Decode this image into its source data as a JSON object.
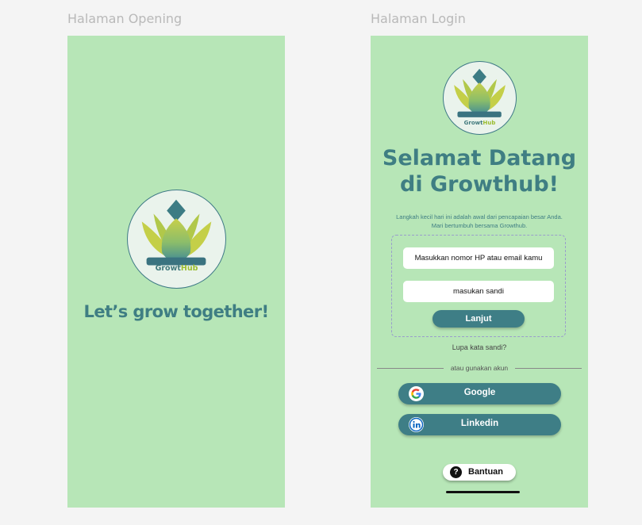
{
  "frames": {
    "opening_title": "Halaman Opening",
    "login_title": "Halaman Login"
  },
  "brand": {
    "name_part1": "Growt",
    "name_part2": "Hub"
  },
  "opening": {
    "tagline": "Let’s grow together!"
  },
  "login": {
    "welcome_line1": "Selamat Datang",
    "welcome_line2": "di Growthub!",
    "subtitle": "Langkah kecil hari ini adalah awal dari pencapaian besar Anda. Mari bertumbuh bersama Growthub.",
    "id_field_placeholder": "Masukkan nomor HP atau email kamu",
    "password_field_placeholder": "masukan sandi",
    "next_button": "Lanjut",
    "forgot_link": "Lupa kata sandi?",
    "divider_text": "atau gunakan akun",
    "google_button": "Google",
    "linkedin_button": "Linkedin",
    "help_button": "Bantuan",
    "help_icon_glyph": "?"
  },
  "colors": {
    "phone_bg": "#b7e6b7",
    "primary": "#3e7e86",
    "logo_green": "#9bbd30"
  },
  "icons": [
    "lotus-logo-icon",
    "google-icon",
    "linkedin-icon",
    "question-icon"
  ]
}
